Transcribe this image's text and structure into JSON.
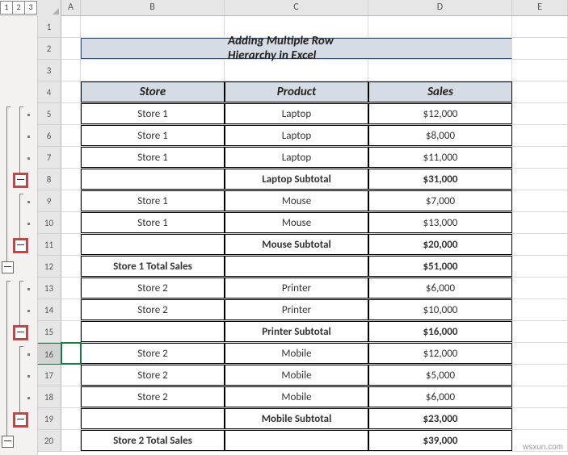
{
  "outline_levels": [
    "1",
    "2",
    "3"
  ],
  "columns": {
    "A": "A",
    "B": "B",
    "C": "C",
    "D": "D",
    "E": "E"
  },
  "title": "Adding Multiple Row Hierarchy in Excel",
  "header": {
    "store": "Store",
    "product": "Product",
    "sales": "Sales"
  },
  "rows": [
    {
      "r": 1
    },
    {
      "r": 2,
      "title": true
    },
    {
      "r": 3
    },
    {
      "r": 4,
      "header": true
    },
    {
      "r": 5,
      "store": "Store 1",
      "product": "Laptop",
      "sales": "$12,000"
    },
    {
      "r": 6,
      "store": "Store 1",
      "product": "Laptop",
      "sales": "$8,000"
    },
    {
      "r": 7,
      "store": "Store 1",
      "product": "Laptop",
      "sales": "$11,000"
    },
    {
      "r": 8,
      "subtotal": "Laptop Subtotal",
      "sales": "$31,000"
    },
    {
      "r": 9,
      "store": "Store 1",
      "product": "Mouse",
      "sales": "$7,000"
    },
    {
      "r": 10,
      "store": "Store 1",
      "product": "Mouse",
      "sales": "$13,000"
    },
    {
      "r": 11,
      "subtotal": "Mouse Subtotal",
      "sales": "$20,000"
    },
    {
      "r": 12,
      "total": "Store 1 Total Sales",
      "sales": "$51,000"
    },
    {
      "r": 13,
      "store": "Store 2",
      "product": "Printer",
      "sales": "$6,000"
    },
    {
      "r": 14,
      "store": "Store 2",
      "product": "Printer",
      "sales": "$10,000"
    },
    {
      "r": 15,
      "subtotal": "Printer Subtotal",
      "sales": "$16,000"
    },
    {
      "r": 16,
      "store": "Store 2",
      "product": "Mobile",
      "sales": "$12,000",
      "selected": true
    },
    {
      "r": 17,
      "store": "Store 2",
      "product": "Mobile",
      "sales": "$5,000"
    },
    {
      "r": 18,
      "store": "Store 2",
      "product": "Mobile",
      "sales": "$6,000"
    },
    {
      "r": 19,
      "subtotal": "Mobile Subtotal",
      "sales": "$23,000"
    },
    {
      "r": 20,
      "total": "Store 2 Total Sales",
      "sales": "$39,000"
    }
  ],
  "watermark": "wsxun.com",
  "outline_highlighted_buttons_rows": [
    8,
    11,
    15,
    19
  ]
}
